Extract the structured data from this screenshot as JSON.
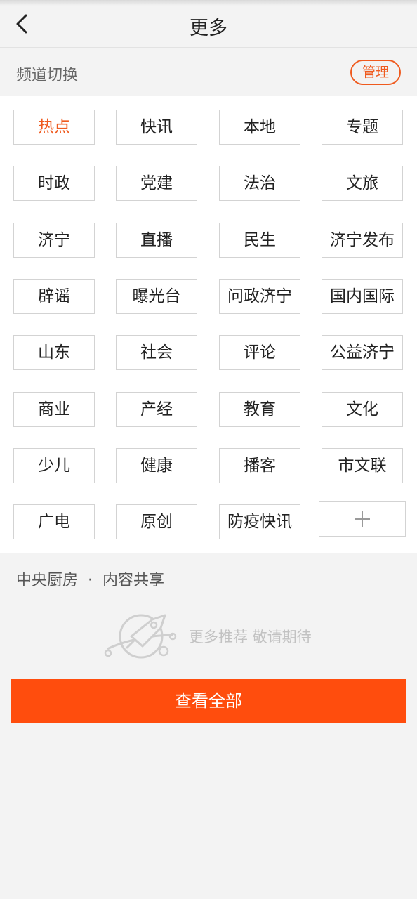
{
  "header": {
    "title": "更多",
    "back_icon": "chevron-left-icon"
  },
  "channel_switch": {
    "label": "频道切换",
    "manage_label": "管理",
    "accent_color": "#ef5a1e"
  },
  "channels": [
    {
      "label": "热点",
      "active": true
    },
    {
      "label": "快讯"
    },
    {
      "label": "本地"
    },
    {
      "label": "专题"
    },
    {
      "label": "时政"
    },
    {
      "label": "党建"
    },
    {
      "label": "法治"
    },
    {
      "label": "文旅"
    },
    {
      "label": "济宁"
    },
    {
      "label": "直播"
    },
    {
      "label": "民生"
    },
    {
      "label": "济宁发布"
    },
    {
      "label": "辟谣"
    },
    {
      "label": "曝光台"
    },
    {
      "label": "问政济宁"
    },
    {
      "label": "国内国际"
    },
    {
      "label": "山东"
    },
    {
      "label": "社会"
    },
    {
      "label": "评论"
    },
    {
      "label": "公益济宁"
    },
    {
      "label": "商业"
    },
    {
      "label": "产经"
    },
    {
      "label": "教育"
    },
    {
      "label": "文化"
    },
    {
      "label": "少儿"
    },
    {
      "label": "健康"
    },
    {
      "label": "播客"
    },
    {
      "label": "市文联"
    },
    {
      "label": "广电"
    },
    {
      "label": "原创"
    },
    {
      "label": "防疫快讯"
    }
  ],
  "add_channel": {
    "icon": "plus-icon"
  },
  "central_kitchen": {
    "title": "中央厨房",
    "separator": "·",
    "subtitle": "内容共享"
  },
  "empty_state": {
    "icon": "rocket-planet-icon",
    "text": "更多推荐 敬请期待"
  },
  "view_all_button": {
    "label": "查看全部",
    "color": "#ff4d0d"
  }
}
